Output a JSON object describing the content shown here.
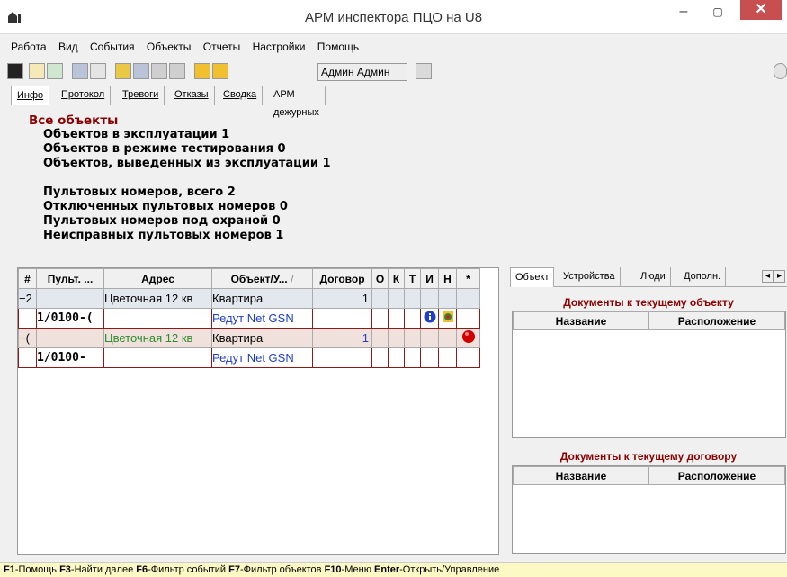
{
  "window": {
    "title": "АРМ инспектора ПЦО на U8",
    "minimize": "–",
    "maximize": "▢",
    "close": "✕"
  },
  "menu": [
    "Работа",
    "Вид",
    "События",
    "Объекты",
    "Отчеты",
    "Настройки",
    "Помощь"
  ],
  "toolbar": {
    "user": "Админ Админ"
  },
  "tabs": [
    "Инфо",
    "Протокол",
    "Тревоги",
    "Отказы",
    "Сводка",
    "АРМ дежурных"
  ],
  "info": {
    "head": "Все объекты",
    "lines1": [
      "Объектов в эксплуатации 1",
      "Объектов в режиме тестирования 0",
      "Объектов, выведенных из эксплуатации 1"
    ],
    "lines2": [
      "Пультовых номеров, всего 2",
      "Отключенных пультовых номеров 0",
      "Пультовых номеров под охраной 0",
      "Неисправных пультовых номеров 1"
    ]
  },
  "grid": {
    "headers": [
      "#",
      "Пульт. ...",
      "Адрес",
      "Объект/У...",
      "Договор",
      "О",
      "К",
      "Т",
      "И",
      "Н",
      "*"
    ],
    "rows": [
      {
        "num": "2",
        "pult": "",
        "address": "Цветочная 12 кв",
        "object": "Квартира",
        "contract": "1"
      },
      {
        "num": "",
        "pult": "1/0100-(",
        "address": "",
        "object": "Редут Net GSN",
        "contract": ""
      },
      {
        "num": "(",
        "pult": "",
        "address": "Цветочная 12 кв",
        "object": "Квартира",
        "contract": "1"
      },
      {
        "num": "",
        "pult": "1/0100-",
        "address": "",
        "object": "Редут Net GSN",
        "contract": ""
      }
    ]
  },
  "right": {
    "tabs": [
      "Объект",
      "Устройства",
      "Люди",
      "Дополн."
    ],
    "docs_object_title": "Документы к текущему объекту",
    "docs_contract_title": "Документы к текущему договору",
    "col_name": "Название",
    "col_location": "Расположение"
  },
  "status": {
    "f1": "F1",
    "f1_text": "-Помощь",
    "f3": "F3",
    "f3_text": "-Найти далее",
    "f6": "F6",
    "f6_text": "-Фильтр событий",
    "f7": "F7",
    "f7_text": "-Фильтр объектов",
    "f10": "F10",
    "f10_text": "-Меню",
    "enter": "Enter",
    "enter_text": "-Открыть/Управление"
  }
}
